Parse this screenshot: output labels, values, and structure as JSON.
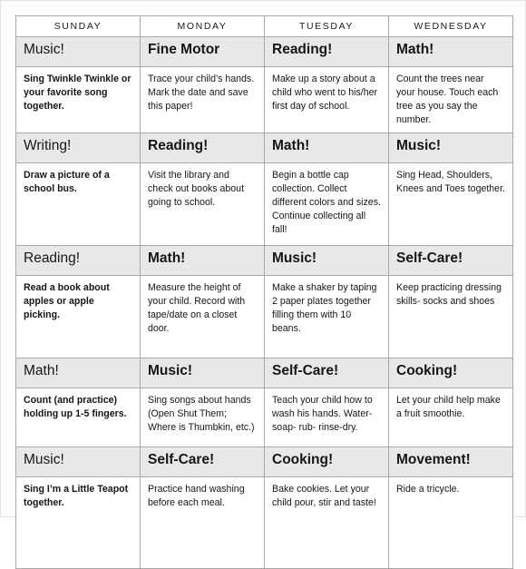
{
  "table": {
    "columns": [
      "SUNDAY",
      "MONDAY",
      "TUESDAY",
      "WEDNESDAY"
    ],
    "rows": [
      {
        "cells": [
          {
            "title": "Music!",
            "body": "Sing Twinkle Twinkle or your favorite song together.",
            "title_weight": "light",
            "body_weight": "bold"
          },
          {
            "title": "Fine Motor",
            "body": "Trace your child’s hands. Mark the date and save this paper!",
            "title_weight": "bold",
            "body_weight": "normal"
          },
          {
            "title": "Reading!",
            "body": "Make up a story about a child who went to his/her first day of school.",
            "title_weight": "bold",
            "body_weight": "normal"
          },
          {
            "title": "Math!",
            "body": "Count the trees near your house.  Touch each tree as you say the number.",
            "title_weight": "bold",
            "body_weight": "normal"
          }
        ]
      },
      {
        "cells": [
          {
            "title": "Writing!",
            "body": "Draw a picture of a school bus.",
            "title_weight": "light",
            "body_weight": "bold"
          },
          {
            "title": "Reading!",
            "body": "Visit the library and check out books about going to school.",
            "title_weight": "bold",
            "body_weight": "normal"
          },
          {
            "title": "Math!",
            "body": "Begin a bottle cap collection. Collect different colors and sizes. Continue collecting all fall!",
            "title_weight": "bold",
            "body_weight": "normal"
          },
          {
            "title": "Music!",
            "body": "Sing Head, Shoulders, Knees and Toes together.",
            "title_weight": "bold",
            "body_weight": "normal"
          }
        ]
      },
      {
        "cells": [
          {
            "title": "Reading!",
            "body": "Read a book about apples or apple picking.",
            "title_weight": "light",
            "body_weight": "bold"
          },
          {
            "title": "Math!",
            "body": "Measure the height of your child. Record with tape/date on a closet door.",
            "title_weight": "bold",
            "body_weight": "normal"
          },
          {
            "title": " Music!",
            "body": "Make a shaker by taping 2 paper plates together filling them with 10 beans.",
            "title_weight": "bold",
            "body_weight": "normal"
          },
          {
            "title": "Self-Care!",
            "body": "Keep practicing dressing skills- socks and shoes",
            "title_weight": "bold",
            "body_weight": "normal"
          }
        ]
      },
      {
        "cells": [
          {
            "title": "Math!",
            "body": "Count (and practice) holding up 1-5 fingers.",
            "title_weight": "light",
            "body_weight": "bold"
          },
          {
            "title": "Music!",
            "body": "Sing songs about hands (Open Shut Them; Where is Thumbkin, etc.)",
            "title_weight": "bold",
            "body_weight": "normal"
          },
          {
            "title": "Self-Care!",
            "body": "Teach your child how to wash his hands. Water- soap- rub- rinse-dry.",
            "title_weight": "bold",
            "body_weight": "normal"
          },
          {
            "title": "Cooking!",
            "body": "Let your child help make a fruit smoothie.",
            "title_weight": "bold",
            "body_weight": "normal"
          }
        ]
      },
      {
        "cells": [
          {
            "title": "Music!",
            "body": "Sing I’m a Little Teapot together.",
            "title_weight": "light",
            "body_weight": "bold"
          },
          {
            "title": "Self-Care!",
            "body": "Practice hand washing before each meal.",
            "title_weight": "bold",
            "body_weight": "normal"
          },
          {
            "title": "Cooking!",
            "body": "Bake cookies.  Let your child pour, stir and taste!",
            "title_weight": "bold",
            "body_weight": "normal"
          },
          {
            "title": "Movement!",
            "body": "Ride a tricycle.",
            "title_weight": "bold",
            "body_weight": "normal"
          }
        ]
      }
    ]
  },
  "colors": {
    "band": "#e8e8e8",
    "border": "#a8a8a8",
    "text": "#15161a",
    "page_bg": "#fdfdfd"
  }
}
